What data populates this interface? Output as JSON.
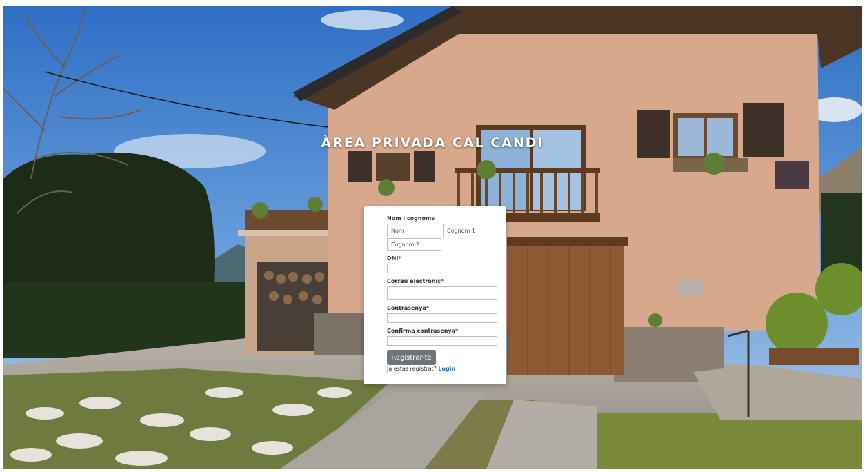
{
  "page": {
    "title": "ÀREA PRIVADA CAL CANDI"
  },
  "form": {
    "name_label": "Nom i cognoms",
    "name_placeholder": "Nom",
    "surname1_placeholder": "Cognom 1",
    "surname2_placeholder": "Cognom 2",
    "dni_label": "DNI",
    "email_label": "Correu electrònic",
    "password_label": "Contrasenya",
    "confirm_label": "Confirma contrasenya",
    "required_mark": "*",
    "submit_label": "Registrar-te",
    "login_prompt": "Ja estàs registrat?",
    "login_link": "Login"
  },
  "colors": {
    "button": "#6c757d",
    "link": "#1a6fd8",
    "required": "#c9302c",
    "card": "#ffffff"
  }
}
